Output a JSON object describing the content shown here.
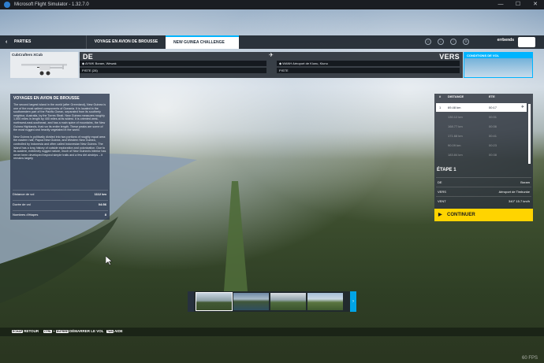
{
  "window": {
    "title": "Microsoft Flight Simulator - 1.32.7.0",
    "minimize": "—",
    "maximize": "☐",
    "close": "✕"
  },
  "nav": {
    "back_label": "PARTIES",
    "back_arrow": "‹",
    "tab_bush": "VOYAGE EN AVION DE BROUSSE",
    "tab_active": "NEW GUINEA CHALLENGE",
    "user": "errbends",
    "icons": [
      "friends-icon",
      "marketplace-icon",
      "notifications-icon",
      "settings-icon"
    ]
  },
  "aircraft": {
    "name": "CubCrafters XCub"
  },
  "flight": {
    "from_label": "DE",
    "to_label": "VERS",
    "from_airport": "AYWK Boram, Wewak",
    "from_runway": "PISTE (28)",
    "to_airport": "WANH Aéroport de Kiunu, Kiunu",
    "to_runway": "PISTE",
    "plane_glyph": "✈"
  },
  "conditions": {
    "label": "CONDITIONS DE VOL"
  },
  "trip": {
    "title": "VOYAGES EN AVION DE BROUSSE",
    "desc_p1": "The second largest island in the world (after Greenland), New Guinea is one of the most salient components of Oceania. It is located in the southwestern part of the Pacific Ocean, separated from its southerly neighbor, Australia, by the Torres Strait. New Guinea measures roughly 1,500 miles in length by 400 miles at its widest. It is oriented west-northwest-east-southeast, and has a main spine of mountains, the New Guinea Highlands, that run its entire length. These peaks are some of the most rugged and heavily vegetated in the world.",
    "desc_p2": "New Guinea is politically divided into two portions of roughly equal area: the eastern half, Papua New Guinea, and Western New Guinea, controlled by Indonesia and often called Indonesian New Guinea. The island has a long history of outside exploration and colonization. Due to its austere, extremely rugged nature, much of New Guinea's interior has never been developed beyond simple trails and a few dirt airstrips – it remains largely",
    "distance_label": "Distance de vol",
    "distance_value": "1112 km",
    "duration_label": "Durée de vol",
    "duration_value": "04:56",
    "stages_label": "Nombres d'étapes",
    "stages_value": "8"
  },
  "legs": {
    "col_n": "#",
    "col_distance": "DISTANCE",
    "col_time": "ETE",
    "rows": [
      {
        "n": "1",
        "distance": "69.48 km",
        "time": "00:17"
      },
      {
        "n": "",
        "distance": "130.12 km",
        "time": "00:31"
      },
      {
        "n": "",
        "distance": "168.77 km",
        "time": "00:36"
      },
      {
        "n": "",
        "distance": "171.68 km",
        "time": "00:41"
      },
      {
        "n": "",
        "distance": "90.09 km",
        "time": "00:23"
      },
      {
        "n": "",
        "distance": "183.84 km",
        "time": "00:38"
      }
    ]
  },
  "stage": {
    "title": "ÉTAPE 1",
    "from_key": "DE",
    "from_value": "Boram",
    "to_key": "VERS",
    "to_value": "Aéroport de Timbunke",
    "wind_key": "VENT",
    "wind_value": "340° 15.7 km/h"
  },
  "continue_label": "CONTINUER",
  "continue_icon": "▶",
  "strip": {
    "left_arrow": "",
    "right_arrow": "›"
  },
  "hints": [
    {
      "key": "ECHAP",
      "label": "RETOUR"
    },
    {
      "key": "CTRL",
      "key2": "ENTRÉE",
      "label": "DÉMARRER LE VOL"
    },
    {
      "key": "TAB",
      "label": "AIDE"
    }
  ],
  "fps": "60 FPS"
}
